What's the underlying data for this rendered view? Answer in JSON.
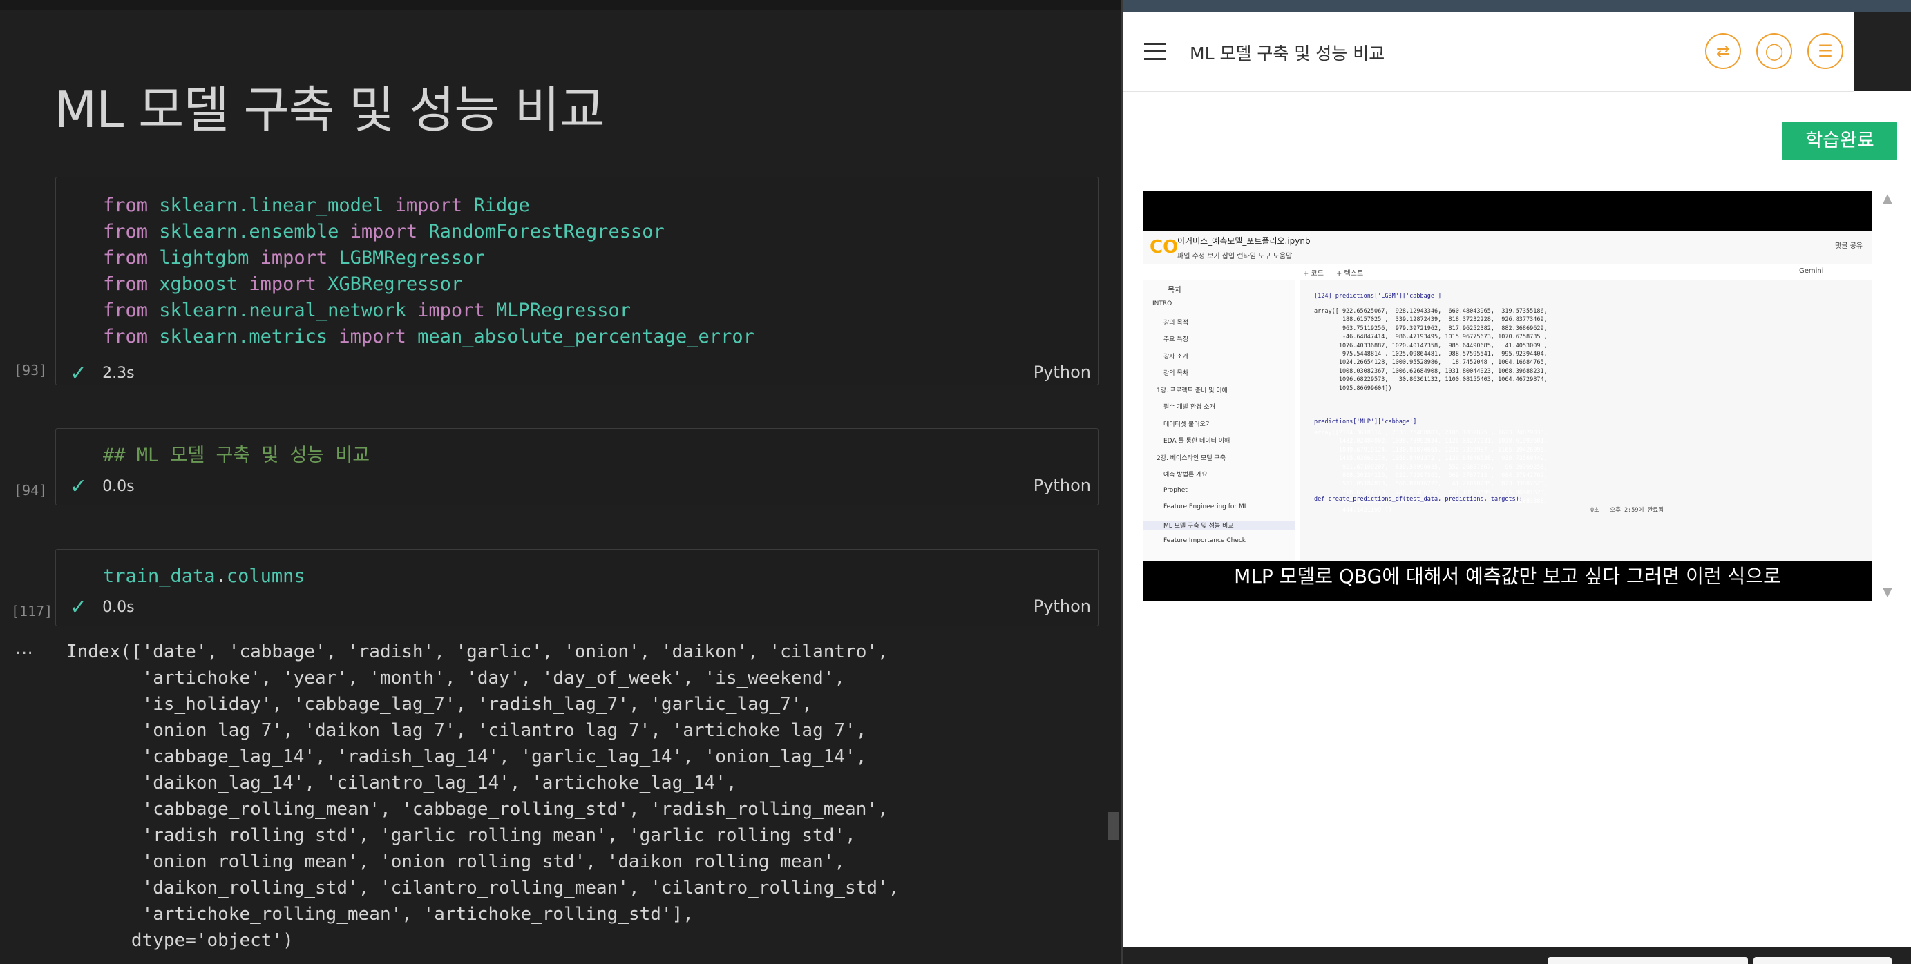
{
  "notebook": {
    "title": "ML 모델 구축 및 성능 비교",
    "cells": [
      {
        "count": "[93]",
        "time": "2.3s",
        "lang": "Python",
        "lines": [
          [
            "from ",
            "sklearn.linear_model",
            " import ",
            "Ridge"
          ],
          [
            "from ",
            "sklearn.ensemble",
            " import ",
            "RandomForestRegressor"
          ],
          [
            "from ",
            "lightgbm",
            " import ",
            "LGBMRegressor"
          ],
          [
            "from ",
            "xgboost",
            " import ",
            "XGBRegressor"
          ],
          [
            "from ",
            "sklearn.neural_network",
            " import ",
            "MLPRegressor"
          ],
          [
            "from ",
            "sklearn.metrics",
            " import ",
            "mean_absolute_percentage_error"
          ]
        ]
      },
      {
        "count": "[94]",
        "time": "0.0s",
        "lang": "Python",
        "text": "## ML 모델 구축 및 성능 비교"
      },
      {
        "count": "[117]",
        "time": "0.0s",
        "lang": "Python",
        "text_obj": "train_data",
        "text_attr": "columns"
      }
    ],
    "output_dots": "…",
    "output": "Index(['date', 'cabbage', 'radish', 'garlic', 'onion', 'daikon', 'cilantro',\n       'artichoke', 'year', 'month', 'day', 'day_of_week', 'is_weekend',\n       'is_holiday', 'cabbage_lag_7', 'radish_lag_7', 'garlic_lag_7',\n       'onion_lag_7', 'daikon_lag_7', 'cilantro_lag_7', 'artichoke_lag_7',\n       'cabbage_lag_14', 'radish_lag_14', 'garlic_lag_14', 'onion_lag_14',\n       'daikon_lag_14', 'cilantro_lag_14', 'artichoke_lag_14',\n       'cabbage_rolling_mean', 'cabbage_rolling_std', 'radish_rolling_mean',\n       'radish_rolling_std', 'garlic_rolling_mean', 'garlic_rolling_std',\n       'onion_rolling_mean', 'onion_rolling_std', 'daikon_rolling_mean',\n       'daikon_rolling_std', 'cilantro_rolling_mean', 'cilantro_rolling_std',\n       'artichoke_rolling_mean', 'artichoke_rolling_std'],\n      dtype='object')"
  },
  "lesson": {
    "title": "ML 모델 구축 및 성능 비교",
    "complete_button": "학습완료",
    "header_icons": [
      "swap-icon",
      "chat-icon",
      "notes-icon"
    ],
    "caption": "MLP 모델로 QBG에 대해서 예측값만 보고 싶다 그러면 이런 식으로"
  },
  "colab": {
    "file_name": "이커머스_예측모델_포트폴리오.ipynb",
    "menu": "파일  수정  보기  삽입  런타임  도구  도움말",
    "top_right": "댓글    공유",
    "toolbar_code": "+ 코드",
    "toolbar_text": "+ 텍스트",
    "toolbar_gemini": "Gemini",
    "toc_head": "목차",
    "toc": [
      "INTRO",
      "강의 목적",
      "주요 특징",
      "강사 소개",
      "강의 목차",
      "1강. 프로젝트 준비 및 이해",
      "필수 개발 환경 소개",
      "데이터셋 불러오기",
      "EDA 를 통한 데이터 이해",
      "2강. 베이스라인 모델 구축",
      "예측 방법론 개요",
      "Prophet",
      "Feature Engineering for ML",
      "ML 모델 구축 및 성능 비교",
      "Feature Importance Check"
    ],
    "code_cell1_label": "[124] predictions['LGBM']['cabbage']",
    "code_cell1_output": "array([ 922.65625067,  928.12943346,  660.48043965,  319.57355186,\n        188.6157025 ,  339.12872439,  818.37232228,  926.83773469,\n        963.75119256,  979.39721962,  817.96252382,  882.36869629,\n        -46.64847414,  986.47193495, 1015.96775673, 1070.6758735 ,\n       1076.40336887, 1020.40147358,  985.64490685,   41.4053009 ,\n        975.5448814 , 1025.09864481,  988.57595541,  995.92394404,\n       1024.26654128, 1000.95528986,   18.7452048 , 1004.16684765,\n       1008.03082367, 1006.62684908, 1031.80044023, 1068.39688231,\n       1096.68229573,   30.86361132, 1100.08155403, 1064.46729874,\n       1095.86699604])",
    "code_cell2_label": "predictions['MLP']['cabbage']",
    "code_cell2_output": "array([2104.3618314 , 2333.75488803, 2106.1832875 , 1623.24879038,\n       1482.02484002, 1088.73992834, 1126.03277031, 1018.61993601,\n       1049.67919124, 1130.81870665, 1235.7335987 , 1165.39426096,\n       1415.03663178, 1056.8401372 , 1136.84846538,  938.73560449,\n        921.67109207,  839.58996035,  552.26887867,   96.29799258,\n        808.30234116,  622.72597362,  669.3787713 ,  684.57942762,\n        551.05184813,  566.81816222,   41.21010235,  823.33807623,\n        718.61391128,  746.66486256,  481.10909699,  586.96901623,\n        608.64387326,   38.44795102,  732.593685  ,  743.92083388,\n        444.1421199 ])",
    "code_cell3": "def create_predictions_df(test_data, predictions, targets):",
    "status": "0초   오후 2:59에 완료됨"
  }
}
